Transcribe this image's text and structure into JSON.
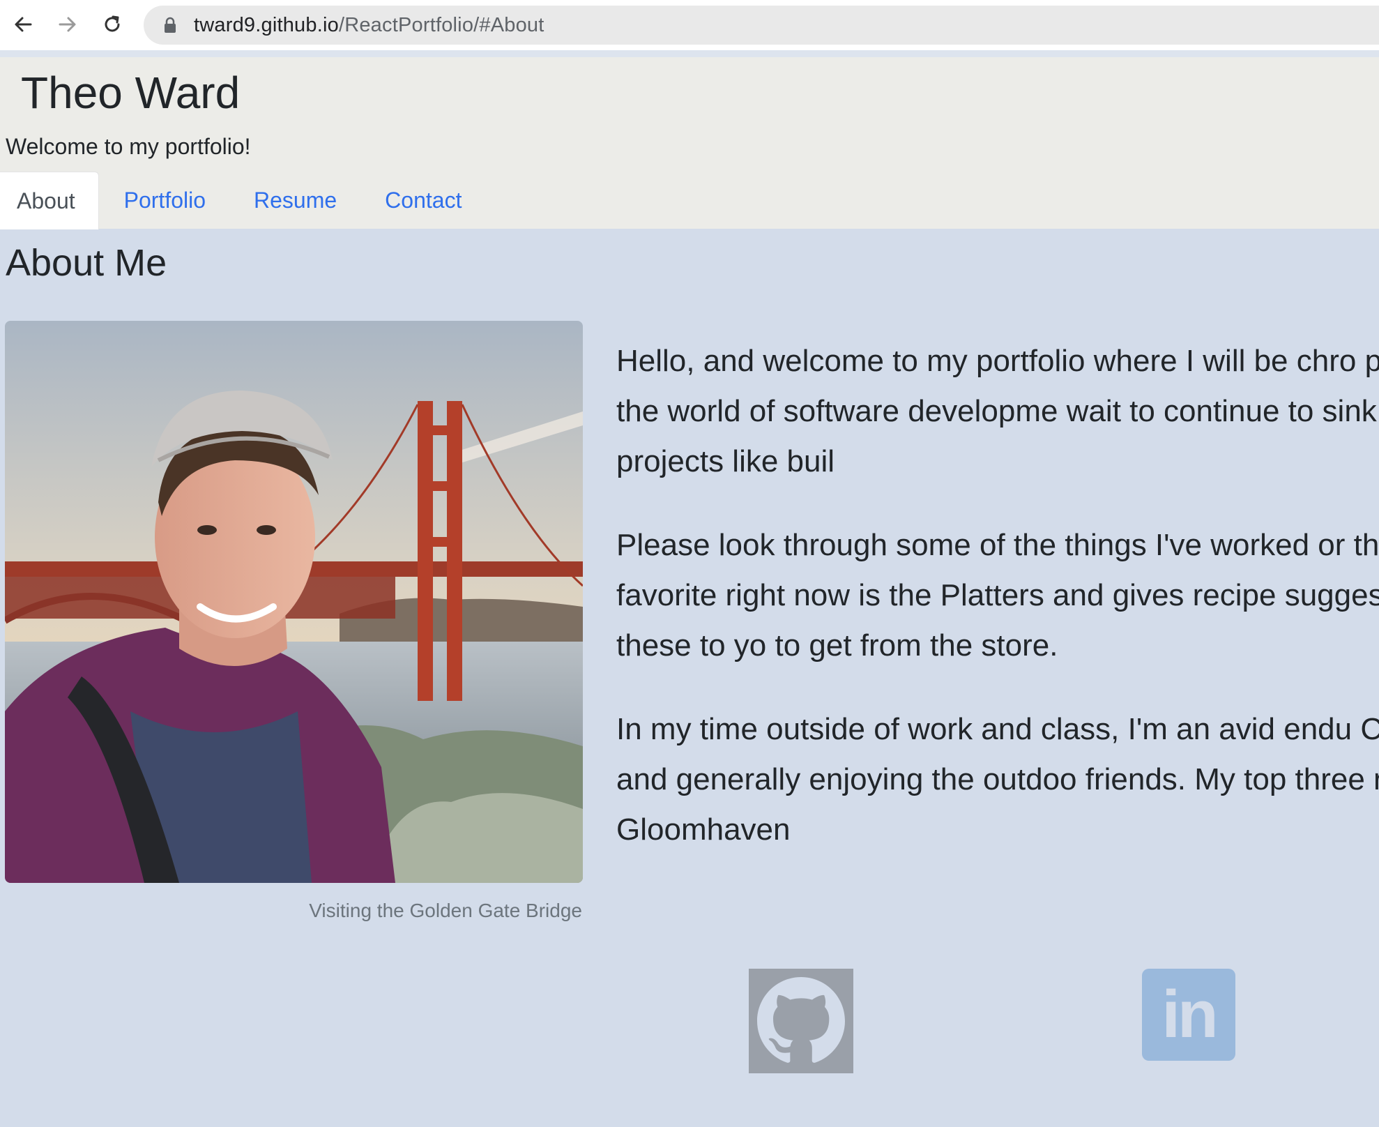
{
  "browser": {
    "url_host": "tward9.github.io",
    "url_path": "/ReactPortfolio/#About"
  },
  "header": {
    "title": "Theo Ward",
    "tagline": "Welcome to my portfolio!",
    "tabs": [
      {
        "label": "About",
        "active": true
      },
      {
        "label": "Portfolio",
        "active": false
      },
      {
        "label": "Resume",
        "active": false
      },
      {
        "label": "Contact",
        "active": false
      }
    ]
  },
  "main": {
    "heading": "About Me",
    "photo_caption": "Visiting the Golden Gate Bridge",
    "paragraphs": [
      "Hello, and welcome to my portfolio where I will be chro physical products, to the world of software developme wait to continue to sink my teeth into projects like buil",
      "Please look through some of the things I've worked or the most proud of. My favorite right now is the Platters and gives recipe suggestions. You can add these to yo to get from the store.",
      "In my time outside of work and class, I'm an avid endu Chicago's lakefront and generally enjoying the outdoo friends. My top three right now are called Gloomhaven"
    ],
    "social": {
      "github_icon": "github-icon",
      "linkedin_label": "in"
    }
  },
  "colors": {
    "page_background": "#d3dcea",
    "header_background": "#ecece8",
    "link": "#2f6fec",
    "github_icon_bg": "#9aa0a9",
    "linkedin_icon_bg": "#9ab9dc"
  }
}
